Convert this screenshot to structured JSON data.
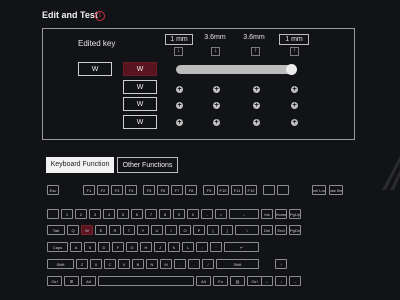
{
  "header": {
    "title": "Edit and Test",
    "info_icon": "info-icon"
  },
  "editor": {
    "edited_key_label": "Edited key",
    "edited_key_value": "W",
    "selected_key": "W",
    "stack_keys": [
      "W",
      "W",
      "W"
    ],
    "distances": [
      "1 mm",
      "3.6mm",
      "3.6mm",
      "1 mm"
    ]
  },
  "tabs": [
    {
      "label": "Keyboard Function",
      "active": true
    },
    {
      "label": "Other Functions",
      "active": false
    }
  ],
  "keyboard": {
    "highlight_color": "#5a1420",
    "row0": [
      "Esc",
      "F1",
      "F2",
      "F3",
      "F4",
      "F5",
      "F6",
      "F7",
      "F8",
      "F9",
      "F10",
      "F11",
      "F12",
      "",
      "",
      "Scrll Lock",
      "Pause Break"
    ],
    "row1": [
      "`",
      "1",
      "2",
      "3",
      "4",
      "5",
      "6",
      "7",
      "8",
      "9",
      "0",
      "-",
      "=",
      "←",
      "Ins",
      "Home",
      "PgUp"
    ],
    "row2": [
      "Tab",
      "Q",
      "W",
      "E",
      "R",
      "T",
      "Y",
      "U",
      "I",
      "O",
      "P",
      "[",
      "]",
      "\\",
      "Del",
      "End",
      "PgDn"
    ],
    "row3": [
      "Caps",
      "A",
      "S",
      "D",
      "F",
      "G",
      "H",
      "J",
      "K",
      "L",
      ";",
      "'",
      "↵"
    ],
    "row4": [
      "Shift",
      "Z",
      "X",
      "C",
      "V",
      "B",
      "N",
      "M",
      ",",
      ".",
      "/",
      "Shift",
      "↑"
    ],
    "row5": [
      "Ctrl",
      "⊞",
      "Alt",
      "",
      "Alt",
      "Fn",
      "▤",
      "Ctrl",
      "←",
      "↓",
      "→"
    ]
  }
}
